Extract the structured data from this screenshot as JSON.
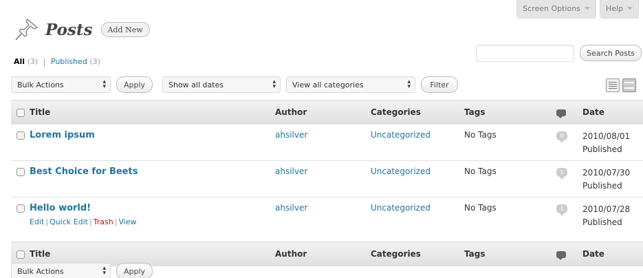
{
  "screen_meta": {
    "screen_options_label": "Screen Options",
    "help_label": "Help"
  },
  "header": {
    "title": "Posts",
    "add_new_label": "Add New"
  },
  "filters": {
    "all_label": "All",
    "all_count": "(3)",
    "published_label": "Published",
    "published_count": "(3)"
  },
  "search": {
    "placeholder": "",
    "button_label": "Search Posts"
  },
  "tablenav_top": {
    "bulk_actions": "Bulk Actions",
    "apply_label": "Apply",
    "dates_select": "Show all dates",
    "categories_select": "View all categories",
    "filter_label": "Filter"
  },
  "table": {
    "columns": {
      "title": "Title",
      "author": "Author",
      "categories": "Categories",
      "tags": "Tags",
      "date": "Date"
    },
    "rows": [
      {
        "title": "Lorem ipsum",
        "author": "ahsilver",
        "categories": "Uncategorized",
        "tags": "No Tags",
        "comments": "0",
        "date": "2010/08/01",
        "status": "Published"
      },
      {
        "title": "Best Choice for Beets",
        "author": "ahsilver",
        "categories": "Uncategorized",
        "tags": "No Tags",
        "comments": "1",
        "date": "2010/07/30",
        "status": "Published"
      },
      {
        "title": "Hello world!",
        "author": "ahsilver",
        "categories": "Uncategorized",
        "tags": "No Tags",
        "comments": "1",
        "date": "2010/07/28",
        "status": "Published",
        "actions": {
          "edit": "Edit",
          "quick_edit": "Quick Edit",
          "trash": "Trash",
          "view": "View"
        }
      }
    ]
  },
  "tablenav_bottom": {
    "bulk_actions": "Bulk Actions",
    "apply_label": "Apply"
  },
  "colors": {
    "link": "#21759b",
    "trash": "#bc0b0b",
    "header_bg": "#dfdfdf"
  }
}
